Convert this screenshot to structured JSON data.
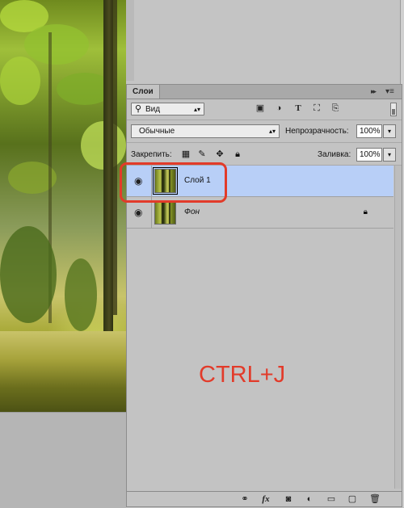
{
  "layers_panel": {
    "tab_label": "Слои",
    "filter": {
      "kind_label": "Вид",
      "icons": [
        "image-filter-icon",
        "adjustment-filter-icon",
        "type-filter-icon",
        "shape-filter-icon",
        "smart-object-filter-icon"
      ]
    },
    "blend_mode": "Обычные",
    "opacity_label": "Непрозрачность:",
    "opacity_value": "100%",
    "lock_label": "Закрепить:",
    "fill_label": "Заливка:",
    "fill_value": "100%",
    "layers": [
      {
        "name": "Слой 1",
        "selected": true,
        "visible": true,
        "locked": false
      },
      {
        "name": "Фон",
        "selected": false,
        "visible": true,
        "locked": true
      }
    ],
    "bottom_icons": [
      "link-layers-icon",
      "fx-icon",
      "layer-mask-icon",
      "adjustment-layer-icon",
      "new-group-icon",
      "new-layer-icon",
      "delete-layer-icon"
    ]
  },
  "annotation": {
    "shortcut_text": "CTRL+J",
    "color": "#e23b2a"
  },
  "colors": {
    "selection": "#b8cff7",
    "panel": "#c3c3c3"
  }
}
